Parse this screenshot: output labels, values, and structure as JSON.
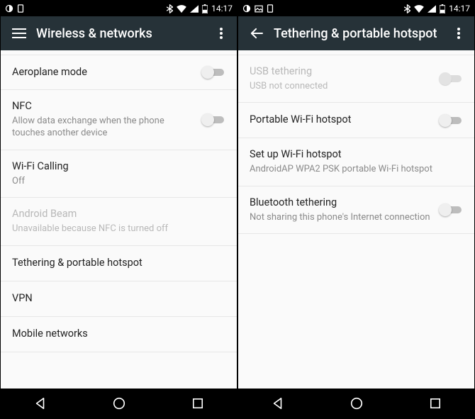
{
  "status": {
    "time": "14:17"
  },
  "left_screen": {
    "title": "Wireless & networks",
    "items": [
      {
        "title": "Aeroplane mode",
        "sub": "",
        "toggle": true,
        "disabled": false
      },
      {
        "title": "NFC",
        "sub": "Allow data exchange when the phone touches another device",
        "toggle": true,
        "disabled": false
      },
      {
        "title": "Wi-Fi Calling",
        "sub": "Off",
        "toggle": false,
        "disabled": false
      },
      {
        "title": "Android Beam",
        "sub": "Unavailable because NFC is turned off",
        "toggle": false,
        "disabled": true
      },
      {
        "title": "Tethering & portable hotspot",
        "sub": "",
        "toggle": false,
        "disabled": false
      },
      {
        "title": "VPN",
        "sub": "",
        "toggle": false,
        "disabled": false
      },
      {
        "title": "Mobile networks",
        "sub": "",
        "toggle": false,
        "disabled": false
      }
    ]
  },
  "right_screen": {
    "title": "Tethering & portable hotspot",
    "items": [
      {
        "title": "USB tethering",
        "sub": "USB not connected",
        "toggle": true,
        "disabled": true
      },
      {
        "title": "Portable Wi-Fi hotspot",
        "sub": "",
        "toggle": true,
        "disabled": false
      },
      {
        "title": "Set up Wi-Fi hotspot",
        "sub": "AndroidAP WPA2 PSK portable Wi-Fi hotspot",
        "toggle": false,
        "disabled": false
      },
      {
        "title": "Bluetooth tethering",
        "sub": "Not sharing this phone's Internet connection",
        "toggle": true,
        "disabled": false
      }
    ]
  }
}
